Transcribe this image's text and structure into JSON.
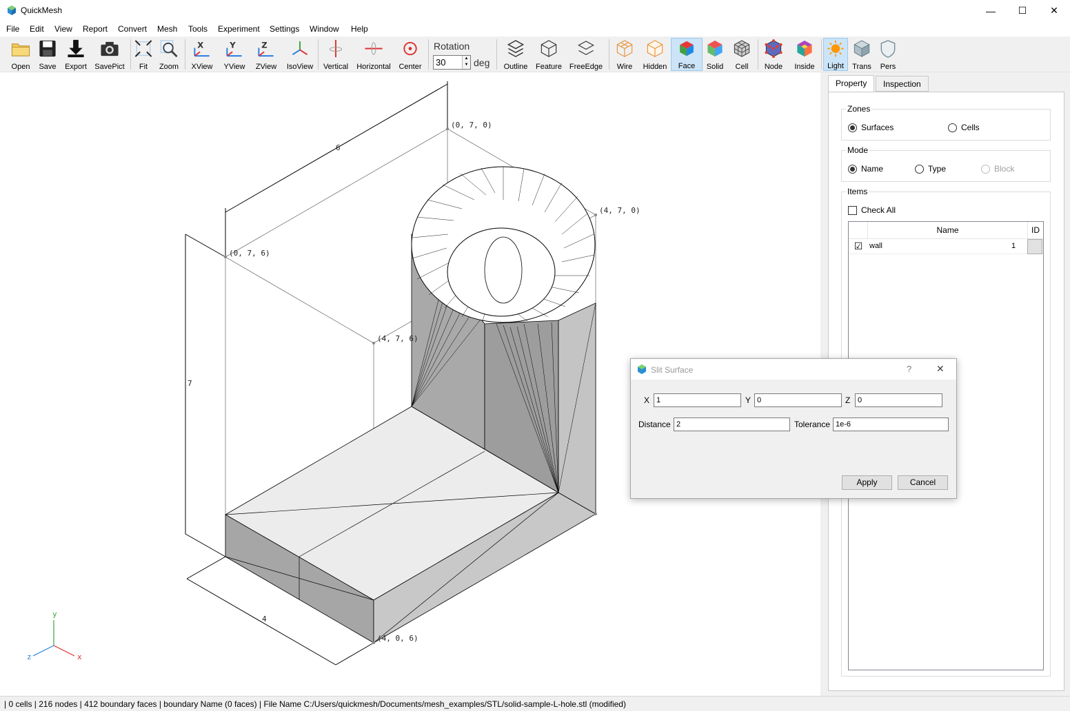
{
  "window": {
    "title": "QuickMesh",
    "minimize": "—",
    "maximize": "☐",
    "close": "✕"
  },
  "menu": [
    "File",
    "Edit",
    "View",
    "Report",
    "Convert",
    "Mesh",
    "Tools",
    "Experiment",
    "Settings",
    "Window",
    "Help"
  ],
  "toolbar": {
    "open": "Open",
    "save": "Save",
    "export": "Export",
    "savepict": "SavePict",
    "fit": "Fit",
    "zoom": "Zoom",
    "xview": "XView",
    "yview": "YView",
    "zview": "ZView",
    "isoview": "IsoView",
    "vertical": "Vertical",
    "horizontal": "Horizontal",
    "center": "Center",
    "rotation_label": "Rotation",
    "rotation_value": "30",
    "rotation_unit": "deg",
    "outline": "Outline",
    "feature": "Feature",
    "freeedge": "FreeEdge",
    "wire": "Wire",
    "hidden": "Hidden",
    "face": "Face",
    "solid": "Solid",
    "cell": "Cell",
    "node": "Node",
    "inside": "Inside",
    "light": "Light",
    "trans": "Trans",
    "pers": "Pers"
  },
  "viewport": {
    "labels": {
      "p1": "(0, 7, 0)",
      "p2": "(4, 7, 0)",
      "p3": "(0, 7, 6)",
      "p4": "(4, 7, 6)",
      "p5": "(4, 0, 6)"
    },
    "dims": {
      "d6": "6",
      "d7": "7",
      "d4": "4"
    },
    "axes": {
      "y": "y",
      "x": "x",
      "z": "z"
    }
  },
  "panel": {
    "tabs": [
      "Property",
      "Inspection"
    ],
    "zones": {
      "title": "Zones",
      "surfaces": "Surfaces",
      "cells": "Cells"
    },
    "mode": {
      "title": "Mode",
      "name": "Name",
      "type": "Type",
      "block": "Block"
    },
    "items": {
      "title": "Items",
      "check_all": "Check All",
      "col_name": "Name",
      "col_id": "ID",
      "rows": [
        {
          "name": "wall",
          "id": "1",
          "checked": "☑"
        }
      ]
    }
  },
  "dialog": {
    "title": "Slit Surface",
    "help": "?",
    "close": "✕",
    "x_label": "X",
    "x_value": "1",
    "y_label": "Y",
    "y_value": "0",
    "z_label": "Z",
    "z_value": "0",
    "distance_label": "Distance",
    "distance_value": "2",
    "tolerance_label": "Tolerance",
    "tolerance_value": "1e-6",
    "apply": "Apply",
    "cancel": "Cancel"
  },
  "status": "| 0 cells | 216 nodes | 412 boundary faces |  boundary Name  (0 faces) | File Name C:/Users/quickmesh/Documents/mesh_examples/STL/solid-sample-L-hole.stl (modified)"
}
